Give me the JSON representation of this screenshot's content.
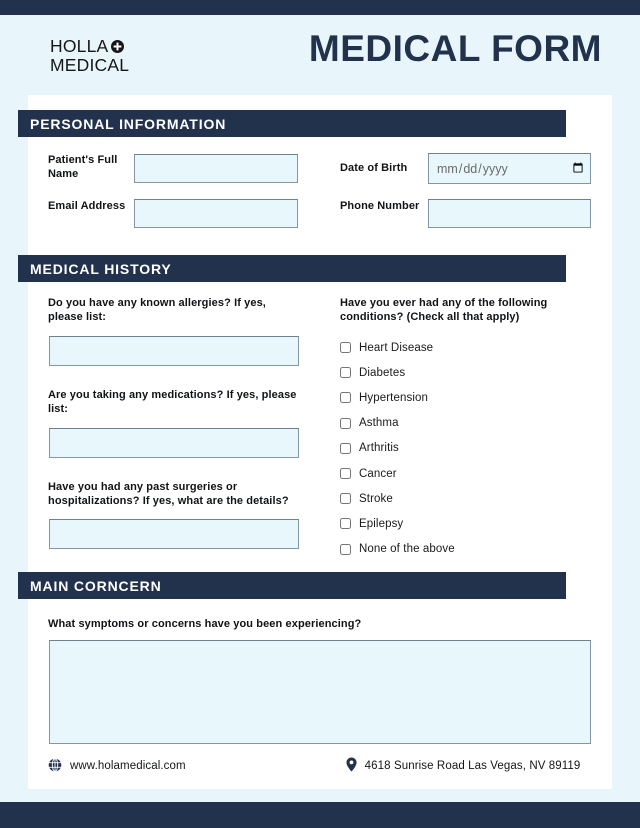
{
  "brand": {
    "logo_line1": "HOLLA",
    "logo_line2": "MEDICAL",
    "logo_icon": "medical-cross-circle-icon"
  },
  "header": {
    "title": "MEDICAL FORM"
  },
  "colors": {
    "navy": "#22314c",
    "page_background": "#e8f6fb",
    "card_background": "#ffffff",
    "field_fill": "#e8f7fb",
    "field_border": "#8496a6"
  },
  "sections": {
    "personal": {
      "heading": "PERSONAL INFORMATION",
      "fields": [
        {
          "label": "Patient's Full Name",
          "value": "",
          "placeholder": ""
        },
        {
          "label": "Date of Birth",
          "value": "",
          "placeholder": "mm/dd/yyyy"
        },
        {
          "label": "Email Address",
          "value": "",
          "placeholder": ""
        },
        {
          "label": "Phone Number",
          "value": "",
          "placeholder": ""
        }
      ]
    },
    "history": {
      "heading": "MEDICAL HISTORY",
      "questions": [
        {
          "label": "Do you have any known allergies? If yes, please list:",
          "value": ""
        },
        {
          "label": "Are you taking any medications? If yes, please list:",
          "value": ""
        },
        {
          "label": "Have you had any past surgeries or hospitalizations? If yes, what are the details?",
          "value": ""
        }
      ],
      "conditions_question": "Have you ever had any of the following conditions? (Check all that apply)",
      "conditions": [
        {
          "label": "Heart Disease",
          "checked": false
        },
        {
          "label": "Diabetes",
          "checked": false
        },
        {
          "label": "Hypertension",
          "checked": false
        },
        {
          "label": "Asthma",
          "checked": false
        },
        {
          "label": "Arthritis",
          "checked": false
        },
        {
          "label": "Cancer",
          "checked": false
        },
        {
          "label": "Stroke",
          "checked": false
        },
        {
          "label": "Epilepsy",
          "checked": false
        },
        {
          "label": "None of the above",
          "checked": false
        }
      ]
    },
    "concern": {
      "heading": "MAIN CORNCERN",
      "question": "What symptoms or concerns have you been experiencing?",
      "value": ""
    }
  },
  "footer": {
    "website_icon": "globe-icon",
    "website": "www.holamedical.com",
    "address_icon": "location-pin-icon",
    "address": "4618 Sunrise Road Las Vegas, NV 89119"
  }
}
